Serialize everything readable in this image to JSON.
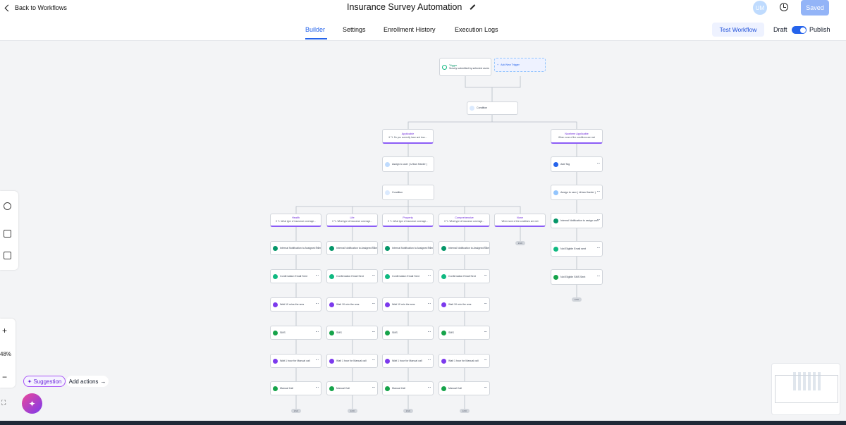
{
  "header": {
    "back_label": "Back to Workflows",
    "title": "Insurance Survey Automation",
    "avatar_initials": "UM",
    "saved_label": "Saved"
  },
  "tabs": [
    {
      "label": "Builder",
      "active": true
    },
    {
      "label": "Settings",
      "active": false
    },
    {
      "label": "Enrollment History",
      "active": false
    },
    {
      "label": "Execution Logs",
      "active": false
    }
  ],
  "actions": {
    "test_workflow": "Test Workflow",
    "draft": "Draft",
    "publish": "Publish",
    "publish_on": true
  },
  "canvas": {
    "zoom": "48%",
    "suggestion": "Suggestion",
    "add_actions": "Add actions",
    "trigger": {
      "title": "Trigger",
      "desc": "Survey submitted by selected users"
    },
    "add_trigger": "Add New Trigger",
    "condition_root": "Condition",
    "branches_top": [
      {
        "title": "Applicable",
        "desc": "If \"1. Do you currently have and insu..."
      },
      {
        "title": "Nowhere Applicable",
        "desc": "When none of the conditions are met"
      }
    ],
    "applicable_steps": [
      "Assign to user ( Urban Harder )",
      "Condition"
    ],
    "not_applicable_steps": [
      "Add Tag",
      "Assign to user ( Urban Harder )",
      "Internal Notification to assign user",
      "Not Eligible Email sent",
      "Not Eligible SMS Sent"
    ],
    "sub_branches": [
      {
        "title": "Health",
        "desc": "If \"1. What type of insurance coverage..."
      },
      {
        "title": "Life",
        "desc": "If \"1. What type of insurance coverage..."
      },
      {
        "title": "Property",
        "desc": "If \"1. What type of insurance coverage..."
      },
      {
        "title": "Comprehensive",
        "desc": "If \"1. What type of insurance coverage..."
      },
      {
        "title": "None",
        "desc": "When none of the conditions are met"
      }
    ],
    "sub_steps": [
      [
        "Internal Notification to Assigned user",
        "Confirmation Email Sent",
        "Wait 10 mins the sms",
        "SMS",
        "Wait 1 hour for Manual call",
        "Manual Call"
      ],
      [
        "Internal Notification to Assigned user",
        "Confirmation Email Sent",
        "Wait 10 min the sms",
        "SMS",
        "Wait 1 hour for Manual call",
        "Manual Call"
      ],
      [
        "Internal Notification to Assigned user",
        "Confirmation Email Sent",
        "Wait 10 min the sms",
        "SMS",
        "Wait 1 hour for Manual call",
        "Manual Call"
      ],
      [
        "Internal Notification to Assigned user",
        "Confirmation Email Sent",
        "Wait 10 min the sms",
        "SMS",
        "Wait 1 hour for Manual call",
        "Manual Call"
      ]
    ],
    "end_label": "END"
  },
  "colors": {
    "accent": "#2563eb",
    "branch": "#8b5cf6",
    "notify": "#059669",
    "email": "#10b981",
    "wait": "#7c3aed",
    "sms": "#16a34a"
  }
}
